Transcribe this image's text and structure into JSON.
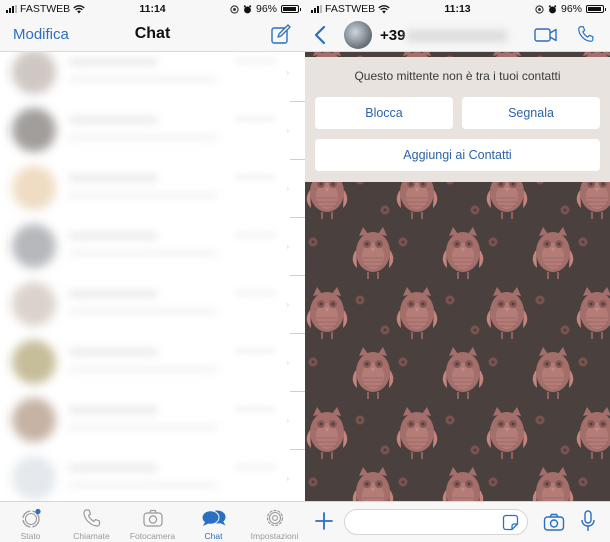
{
  "left": {
    "statusbar": {
      "carrier": "FASTWEB",
      "time": "11:14",
      "battery": "96%"
    },
    "navbar": {
      "edit_label": "Modifica",
      "title": "Chat",
      "compose_icon": "compose-icon"
    },
    "chat_list": {
      "note": "blurred",
      "avatar_colors": [
        "#b5aaa3",
        "#6f6a66",
        "#e8c9a3",
        "#8f9299",
        "#c8bcb0",
        "#a89a63",
        "#a88a74",
        "#d6dde4"
      ]
    },
    "tabbar": {
      "tabs": [
        {
          "label": "Stato",
          "icon": "status-icon",
          "active": false
        },
        {
          "label": "Chiamate",
          "icon": "phone-icon",
          "active": false
        },
        {
          "label": "Fotocamera",
          "icon": "camera-icon",
          "active": false
        },
        {
          "label": "Chat",
          "icon": "chat-bubbles-icon",
          "active": true
        },
        {
          "label": "Impostazioni",
          "icon": "settings-gear-icon",
          "active": false
        }
      ]
    }
  },
  "right": {
    "statusbar": {
      "carrier": "FASTWEB",
      "time": "11:13",
      "battery": "96%"
    },
    "navbar": {
      "contact_name": "+39",
      "back_icon": "back-chevron-icon",
      "video_icon": "video-call-icon",
      "call_icon": "phone-icon"
    },
    "banner": {
      "message": "Questo mittente non è tra i tuoi contatti",
      "block_label": "Blocca",
      "report_label": "Segnala",
      "add_label": "Aggiungi ai Contatti"
    },
    "composer": {
      "input_value": "",
      "input_placeholder": "",
      "plus_icon": "plus-icon",
      "sticker_icon": "sticker-icon",
      "camera_icon": "camera-icon",
      "mic_icon": "microphone-icon"
    }
  },
  "colors": {
    "accent": "#2a6fc1",
    "button_text": "#2d63a8",
    "wallpaper_bg": "#4a413f",
    "owl": "#b07772",
    "owl_dark": "#8a5d5a",
    "banner_bg": "#e9e3df"
  }
}
